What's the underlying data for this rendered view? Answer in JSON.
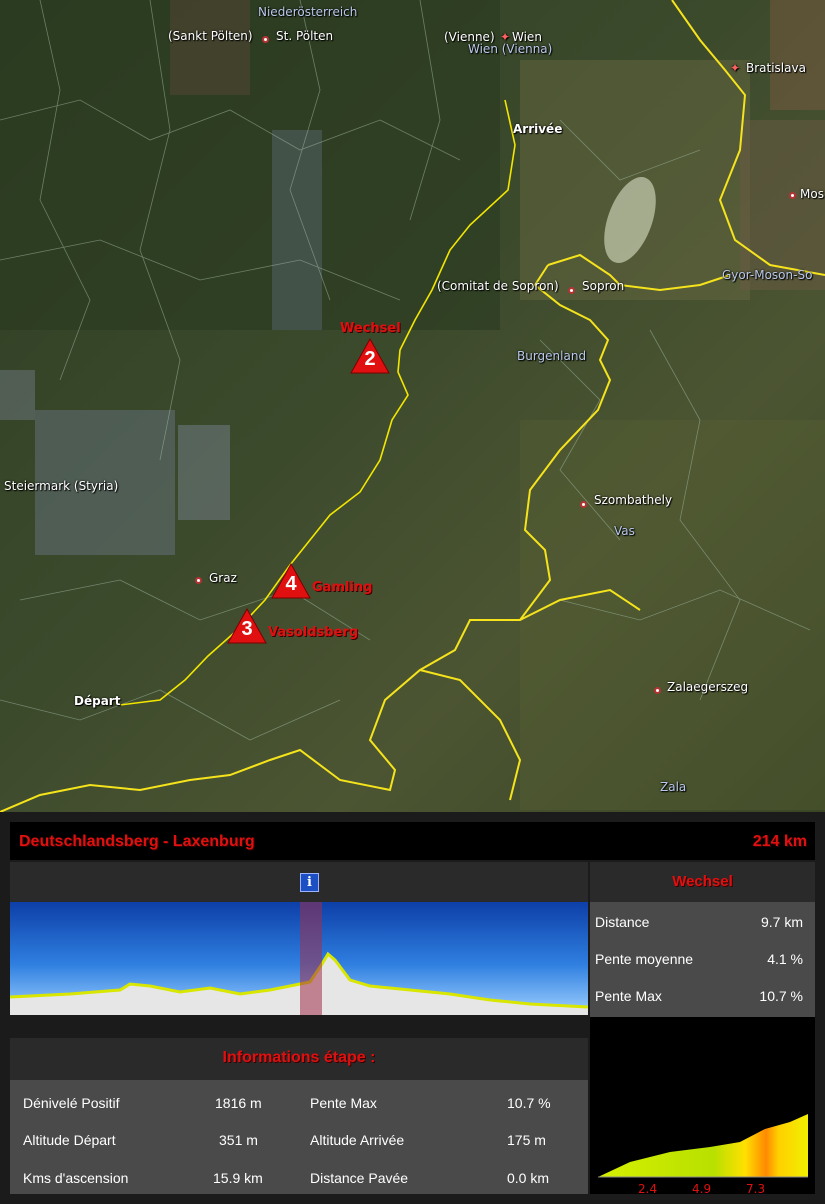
{
  "map": {
    "regions": [
      "Niederösterreich",
      "Steiermark (Styria)",
      "Burgenland",
      "Vas",
      "Zala",
      "Gyor-Moson-So"
    ],
    "cities": [
      "(Sankt Pölten)",
      "St. Pölten",
      "(Vienne)",
      "Wien",
      "Wien (Vienna)",
      "Bratislava",
      "Mos",
      "(Comitat de Sopron)",
      "Sopron",
      "Szombathely",
      "Graz",
      "Zalaegerszeg"
    ],
    "route_labels": {
      "start": "Départ",
      "finish": "Arrivée"
    },
    "climbs": [
      {
        "number": "2",
        "name": "Wechsel"
      },
      {
        "number": "4",
        "name": "Gamling"
      },
      {
        "number": "3",
        "name": "Vasoldsberg"
      }
    ],
    "colors": {
      "route": "#f2e600",
      "border": "#f5e31c",
      "climb": "#e01010"
    }
  },
  "stage": {
    "title": "Deutschlandsberg - Laxenburg",
    "distance": "214 km"
  },
  "info_icon": "info-icon",
  "climb": {
    "name": "Wechsel",
    "stats": [
      {
        "label": "Distance",
        "value": "9.7 km"
      },
      {
        "label": "Pente moyenne",
        "value": "4.1 %"
      },
      {
        "label": "Pente Max",
        "value": "10.7 %"
      }
    ],
    "profile_ticks": [
      "2.4",
      "4.9",
      "7.3"
    ]
  },
  "infos": {
    "heading": "Informations étape :",
    "rows": [
      {
        "label": "Dénivelé Positif",
        "value": "1816 m",
        "label2": "Pente Max",
        "value2": "10.7 %"
      },
      {
        "label": "Altitude Départ",
        "value": "351 m",
        "label2": "Altitude Arrivée",
        "value2": "175 m"
      },
      {
        "label": "Kms d'ascension",
        "value": "15.9 km",
        "label2": "Distance Pavée",
        "value2": "0.0 km"
      }
    ]
  }
}
